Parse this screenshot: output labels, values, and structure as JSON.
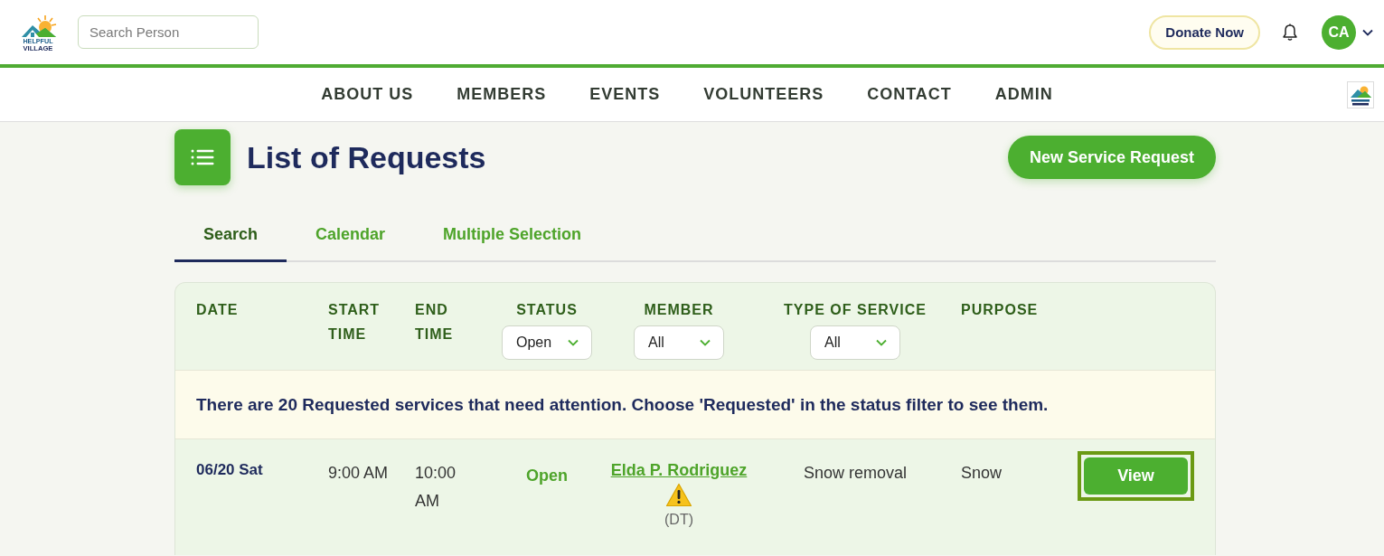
{
  "header": {
    "logo": {
      "line1": "HELPFUL",
      "line2": "VILLAGE"
    },
    "search": {
      "placeholder": "Search Person"
    },
    "donate_button": "Donate Now",
    "avatar": "CA"
  },
  "nav": [
    "ABOUT US",
    "MEMBERS",
    "EVENTS",
    "VOLUNTEERS",
    "CONTACT",
    "ADMIN"
  ],
  "page": {
    "title": "List of Requests",
    "new_button": "New Service Request"
  },
  "tabs": [
    {
      "label": "Search",
      "selected": true
    },
    {
      "label": "Calendar",
      "selected": false
    },
    {
      "label": "Multiple Selection",
      "selected": false
    }
  ],
  "table": {
    "columns": [
      {
        "label": "DATE",
        "kind": "text"
      },
      {
        "label": "START TIME",
        "kind": "text"
      },
      {
        "label": "END TIME",
        "kind": "text"
      },
      {
        "label": "STATUS",
        "kind": "filter",
        "filter": "Open"
      },
      {
        "label": "MEMBER",
        "kind": "filter",
        "filter": "All"
      },
      {
        "label": "TYPE OF SERVICE",
        "kind": "filter",
        "filter": "All"
      },
      {
        "label": "PURPOSE",
        "kind": "text"
      }
    ],
    "notice": "There are 20 Requested services that need attention. Choose 'Requested' in the status filter to see them.",
    "rows": [
      {
        "date": "06/20 Sat",
        "start_time": "9:00 AM",
        "end_time": "10:00 AM",
        "status": "Open",
        "member": "Elda P. Rodriguez",
        "member_warning": true,
        "member_note": "(DT)",
        "service": "Snow removal",
        "purpose": "Snow",
        "action": {
          "label": "View",
          "focused": true
        }
      }
    ]
  }
}
